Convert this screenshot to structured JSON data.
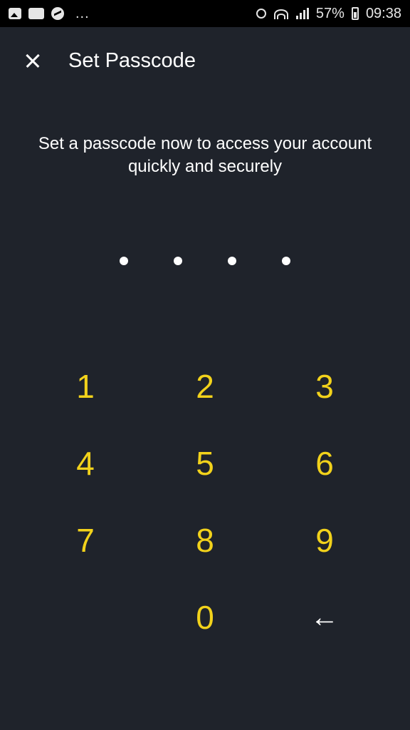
{
  "status_bar": {
    "battery": "57%",
    "time": "09:38",
    "more": "...",
    "left_icons": [
      "picture-icon",
      "app-icon",
      "messenger-icon"
    ],
    "right_icons": [
      "alarm-icon",
      "wifi-icon",
      "signal-icon",
      "battery-icon"
    ]
  },
  "app_bar": {
    "title": "Set Passcode",
    "close_icon": "close-icon"
  },
  "instruction": "Set a passcode now to access your account quickly and securely",
  "passcode": {
    "length": 4,
    "filled": 4
  },
  "keypad": {
    "keys": [
      "1",
      "2",
      "3",
      "4",
      "5",
      "6",
      "7",
      "8",
      "9",
      "",
      "0",
      "←"
    ]
  },
  "colors": {
    "background": "#1f232b",
    "status_bar": "#000000",
    "key_accent": "#f2d21b",
    "text": "#ffffff"
  }
}
